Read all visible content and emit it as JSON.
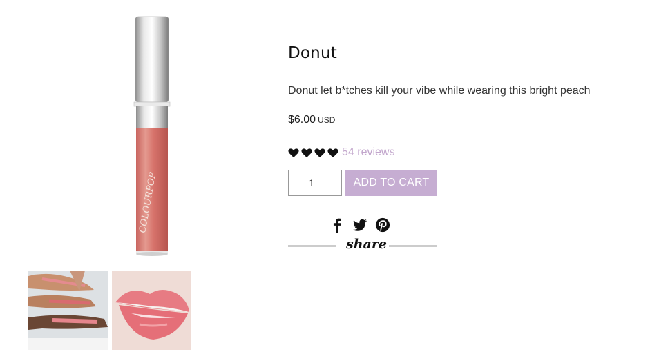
{
  "product": {
    "title": "Donut",
    "description": "Donut let b*tches kill your vibe while wearing this bright peach",
    "price": "$6.00",
    "currency": "USD",
    "rating_hearts": 4,
    "reviews_label": "54 reviews",
    "quantity": "1",
    "add_to_cart_label": "ADD TO CART",
    "share_label": "share",
    "accent_color": "#c6add2",
    "reviews_color": "#c2a6cc"
  },
  "gallery": {
    "main_image_icon": "lip-gloss-tube-image",
    "tube_label": "COLOURPOP",
    "thumbnails": [
      "arm-swatches-image",
      "lips-swatch-image"
    ]
  },
  "share_icons": [
    "facebook-icon",
    "twitter-icon",
    "pinterest-icon"
  ]
}
